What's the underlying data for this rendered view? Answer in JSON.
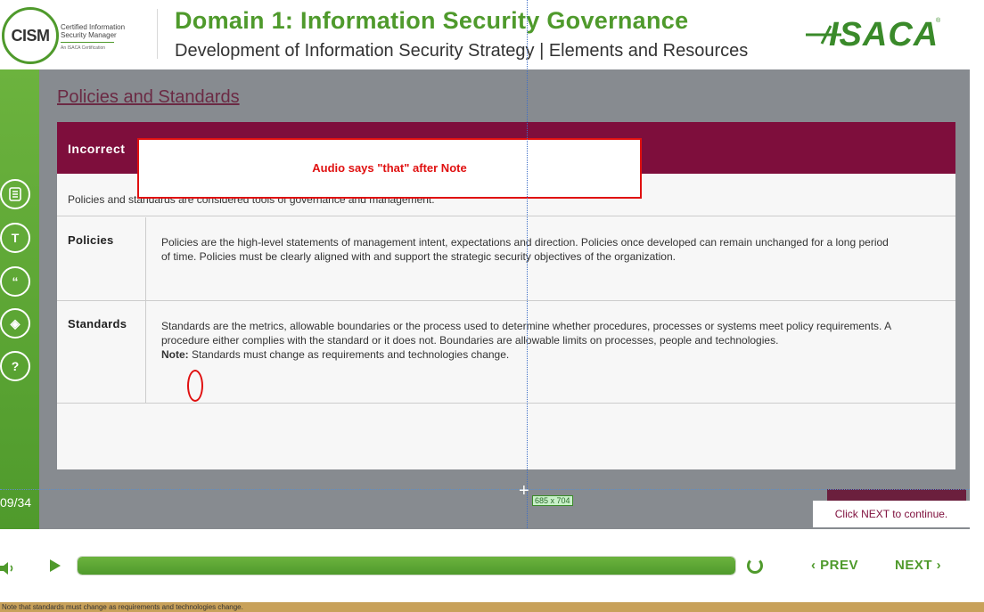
{
  "header": {
    "cism_logo_text": "CISM",
    "cism_subtitle_line1": "Certified Information",
    "cism_subtitle_line2": "Security Manager",
    "cism_subtitle_tiny": "An ISACA Certification",
    "title": "Domain 1: Information Security Governance",
    "subtitle": "Development of Information Security Strategy | Elements and Resources",
    "isaca_logo_text": "ISACA"
  },
  "sidebar": {
    "buttons": [
      {
        "icon": "notes-icon",
        "glyph": "≡"
      },
      {
        "icon": "transcript-icon",
        "glyph": "T"
      },
      {
        "icon": "quote-icon",
        "glyph": "“"
      },
      {
        "icon": "resources-icon",
        "glyph": "◈"
      },
      {
        "icon": "help-icon",
        "glyph": "?"
      }
    ],
    "page_counter": "09/34"
  },
  "slide": {
    "title": "Policies and Standards",
    "panel_header": "Incorrect",
    "intro": "Policies and standards are considered tools of governance and management.",
    "rows": [
      {
        "label": "Policies",
        "body": "Policies are the high-level statements of management intent, expectations and direction. Policies once developed can remain unchanged for a long period of time. Policies must be clearly aligned with and support the strategic security objectives of the organization."
      },
      {
        "label": "Standards",
        "body": "Standards are the metrics, allowable boundaries or the process used to determine whether procedures, processes or systems meet policy requirements. A procedure either complies with the standard or it does not. Boundaries are allowable limits on processes, people and technologies.",
        "note_label": "Note:",
        "note_text": " Standards must change as requirements and technologies change."
      }
    ],
    "callout": "Audio says \"that\" after Note",
    "next_hint": "Click NEXT to continue.",
    "dimension_tooltip": "685 x 704"
  },
  "controls": {
    "prev_label": "‹ PREV",
    "next_label": "NEXT ›",
    "progress": 1.0
  },
  "footer": {
    "text": "Note that standards must change as requirements and technologies change."
  },
  "colors": {
    "accent_green": "#4f9a2c",
    "maroon": "#7e0e3c",
    "callout_red": "#e01010",
    "overlay_grey": "#878b90"
  }
}
